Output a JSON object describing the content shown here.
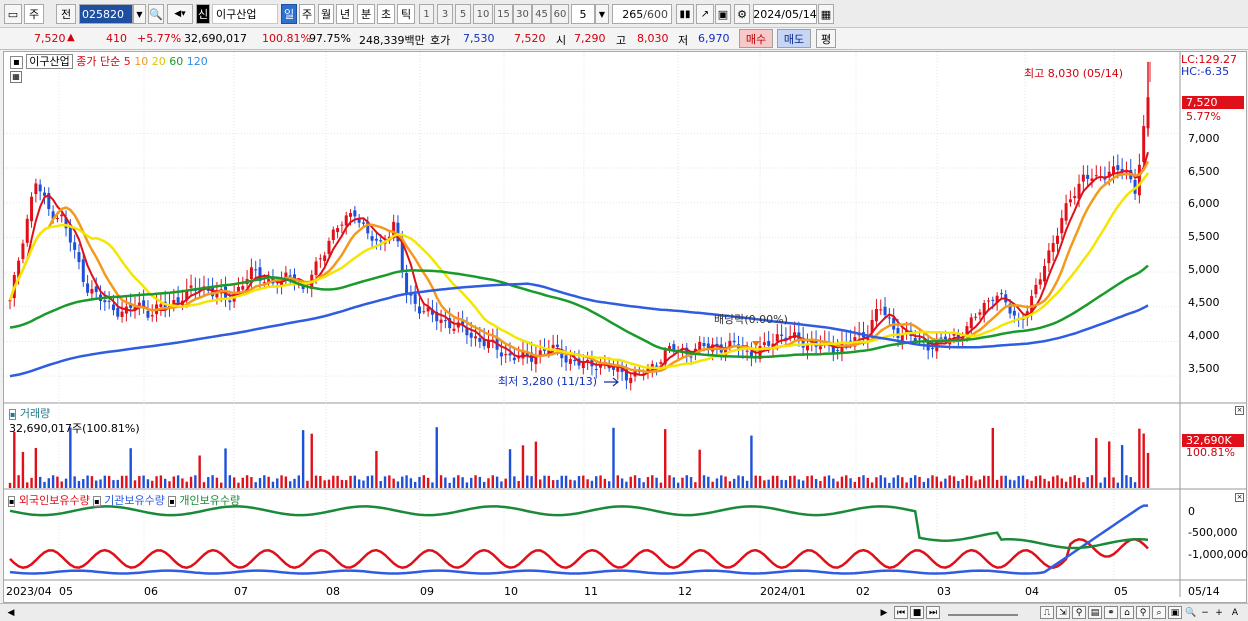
{
  "toolbar": {
    "market": "주",
    "prev_label": "전",
    "code": "025820",
    "stock_badge": "신",
    "stock_name": "이구산업",
    "periods": [
      "일",
      "주",
      "월",
      "년",
      "분",
      "초",
      "틱"
    ],
    "active_period": "일",
    "intervals": [
      "1",
      "3",
      "5",
      "10",
      "15",
      "30",
      "45",
      "60"
    ],
    "interval_value": "5",
    "count": "265",
    "count_max": "/600",
    "date": "2024/05/14"
  },
  "quote": {
    "price": "7,520",
    "arrow": "▲",
    "change": "410",
    "change_pct": "+5.77%",
    "volume": "32,690,017",
    "vol_ratio": "100.81%",
    "turnover": "97.75%",
    "amount": "248,339백만",
    "hoga_label": "호가",
    "ask": "7,530",
    "bid": "7,520",
    "open_label": "시",
    "open": "7,290",
    "high_label": "고",
    "high": "8,030",
    "low_label": "저",
    "low": "6,970",
    "buy_label": "매수",
    "sell_label": "매도",
    "eval_label": "평"
  },
  "price_panel": {
    "stock_name": "이구산업",
    "ma_label": "종가 단순",
    "ma_periods": [
      "5",
      "10",
      "20",
      "60",
      "120"
    ],
    "ma_colors": [
      "#e0101b",
      "#f29a1c",
      "#f5e600",
      "#1a9a2a",
      "#2f5ce0"
    ],
    "lc": "LC:129.27",
    "hc": "HC:-6.35",
    "high_note": "최고 8,030 (05/14)",
    "low_note": "최저 3,280 (11/13)",
    "dividend_note": "배당락(0.00%)",
    "current_price_tag": "7,520",
    "current_pct_tag": "5.77%",
    "y_ticks": [
      "7,000",
      "6,500",
      "6,000",
      "5,500",
      "5,000",
      "4,500",
      "4,000",
      "3,500"
    ]
  },
  "volume_panel": {
    "title": "거래량",
    "value": "32,690,017주(100.81%)",
    "tag_value": "32,690K",
    "tag_pct": "100.81%"
  },
  "holding_panel": {
    "series": [
      "외국인보유수량",
      "기관보유수량",
      "개인보유수량"
    ],
    "colors": [
      "#e0101b",
      "#2f5ce0",
      "#1a8a3a"
    ],
    "y_ticks": [
      "0",
      "-500,000",
      "-1,000,000"
    ]
  },
  "x_axis": {
    "labels": [
      "2023/04",
      "05",
      "06",
      "07",
      "08",
      "09",
      "10",
      "11",
      "12",
      "2024/01",
      "02",
      "03",
      "04",
      "05"
    ],
    "right_label": "05/14"
  },
  "chart_data": {
    "type": "candlestick",
    "x_start": "2023/04",
    "x_end": "2024/05/14",
    "ylim": [
      3200,
      8100
    ],
    "close_approx": [
      4550,
      5500,
      6300,
      5900,
      5800,
      5300,
      4800,
      4600,
      4500,
      4400,
      4550,
      4400,
      4500,
      4600,
      4700,
      4800,
      4700,
      4600,
      4800,
      5000,
      4900,
      4800,
      5000,
      4700,
      5100,
      5500,
      5700,
      5900,
      5500,
      5400,
      5700,
      4700,
      4500,
      4350,
      4300,
      4200,
      4100,
      4000,
      3900,
      3800,
      3750,
      3800,
      3900,
      3850,
      3700,
      3650,
      3700,
      3600,
      3550,
      3500,
      3600,
      3800,
      3900,
      3850,
      3900,
      3950,
      3900,
      3950,
      3800,
      3900,
      4100,
      4050,
      4000,
      3950,
      3900,
      3950,
      4000,
      4150,
      4500,
      4200,
      4100,
      4000,
      3950,
      4000,
      4100,
      4200,
      4500,
      4700,
      4500,
      4300,
      4600,
      5200,
      5600,
      6100,
      6400,
      6300,
      6500,
      6450,
      6200,
      7520
    ],
    "high": 8030,
    "high_date": "05/14",
    "low": 3280,
    "low_date": "11/13",
    "last": 7520
  }
}
